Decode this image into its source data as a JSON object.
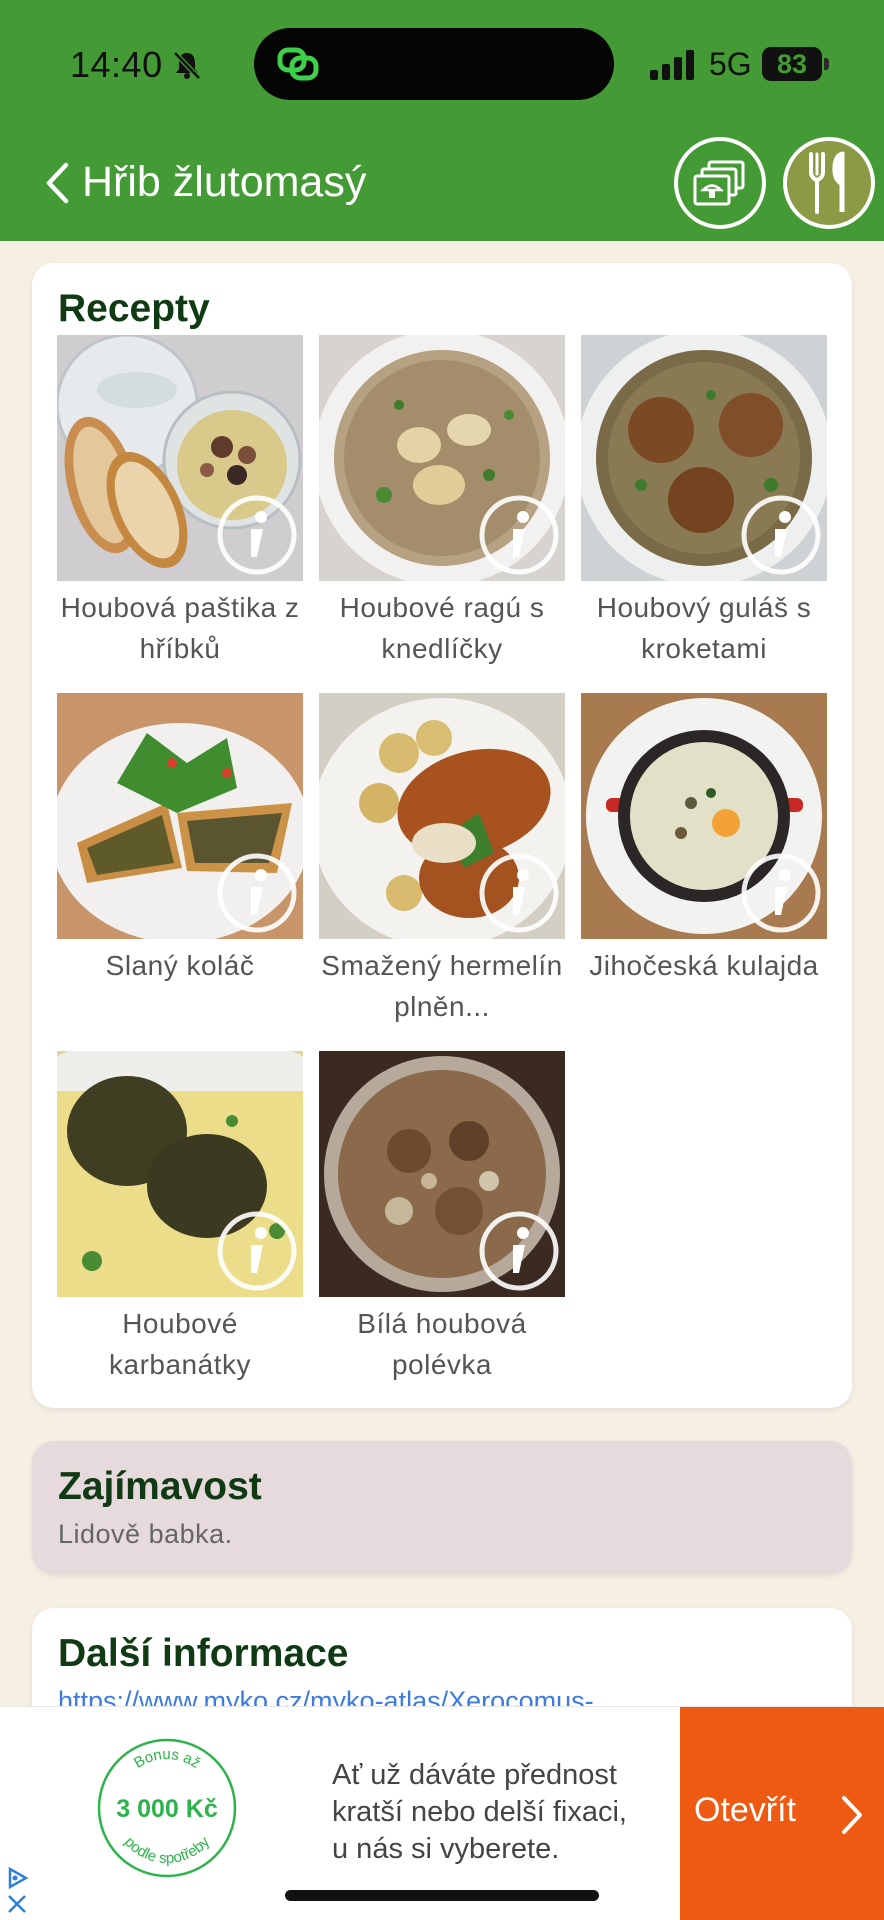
{
  "status": {
    "time": "14:40",
    "network": "5G",
    "battery": "83"
  },
  "header": {
    "back_label": "",
    "title": "Hřib žlutomasý"
  },
  "recipes": {
    "title": "Recepty",
    "items": [
      {
        "name": "Houbová paštika z hříbků"
      },
      {
        "name": "Houbové ragú s knedlíčky"
      },
      {
        "name": "Houbový guláš s kroketami"
      },
      {
        "name": "Slaný koláč"
      },
      {
        "name": "Smažený hermelín plněn..."
      },
      {
        "name": "Jihočeská kulajda"
      },
      {
        "name": "Houbové karbanátky"
      },
      {
        "name": "Bílá houbová polévka"
      }
    ]
  },
  "fact": {
    "title": "Zajímavost",
    "text": "Lidově babka."
  },
  "more": {
    "title": "Další informace",
    "link": "https://www.myko.cz/myko-atlas/Xerocomus-"
  },
  "ad": {
    "badge_top": "Bonus až",
    "badge_amount": "3 000 Kč",
    "badge_bottom": "podle spotřeby",
    "text_line1": "Ať už dáváte přednost",
    "text_line2": "kratší nebo delší fixaci,",
    "text_line3": "u nás si vyberete.",
    "cta": "Otevřít"
  },
  "colors": {
    "header_green": "#449a34",
    "accent_orange": "#ef5a12",
    "title_green": "#0f3a14"
  }
}
